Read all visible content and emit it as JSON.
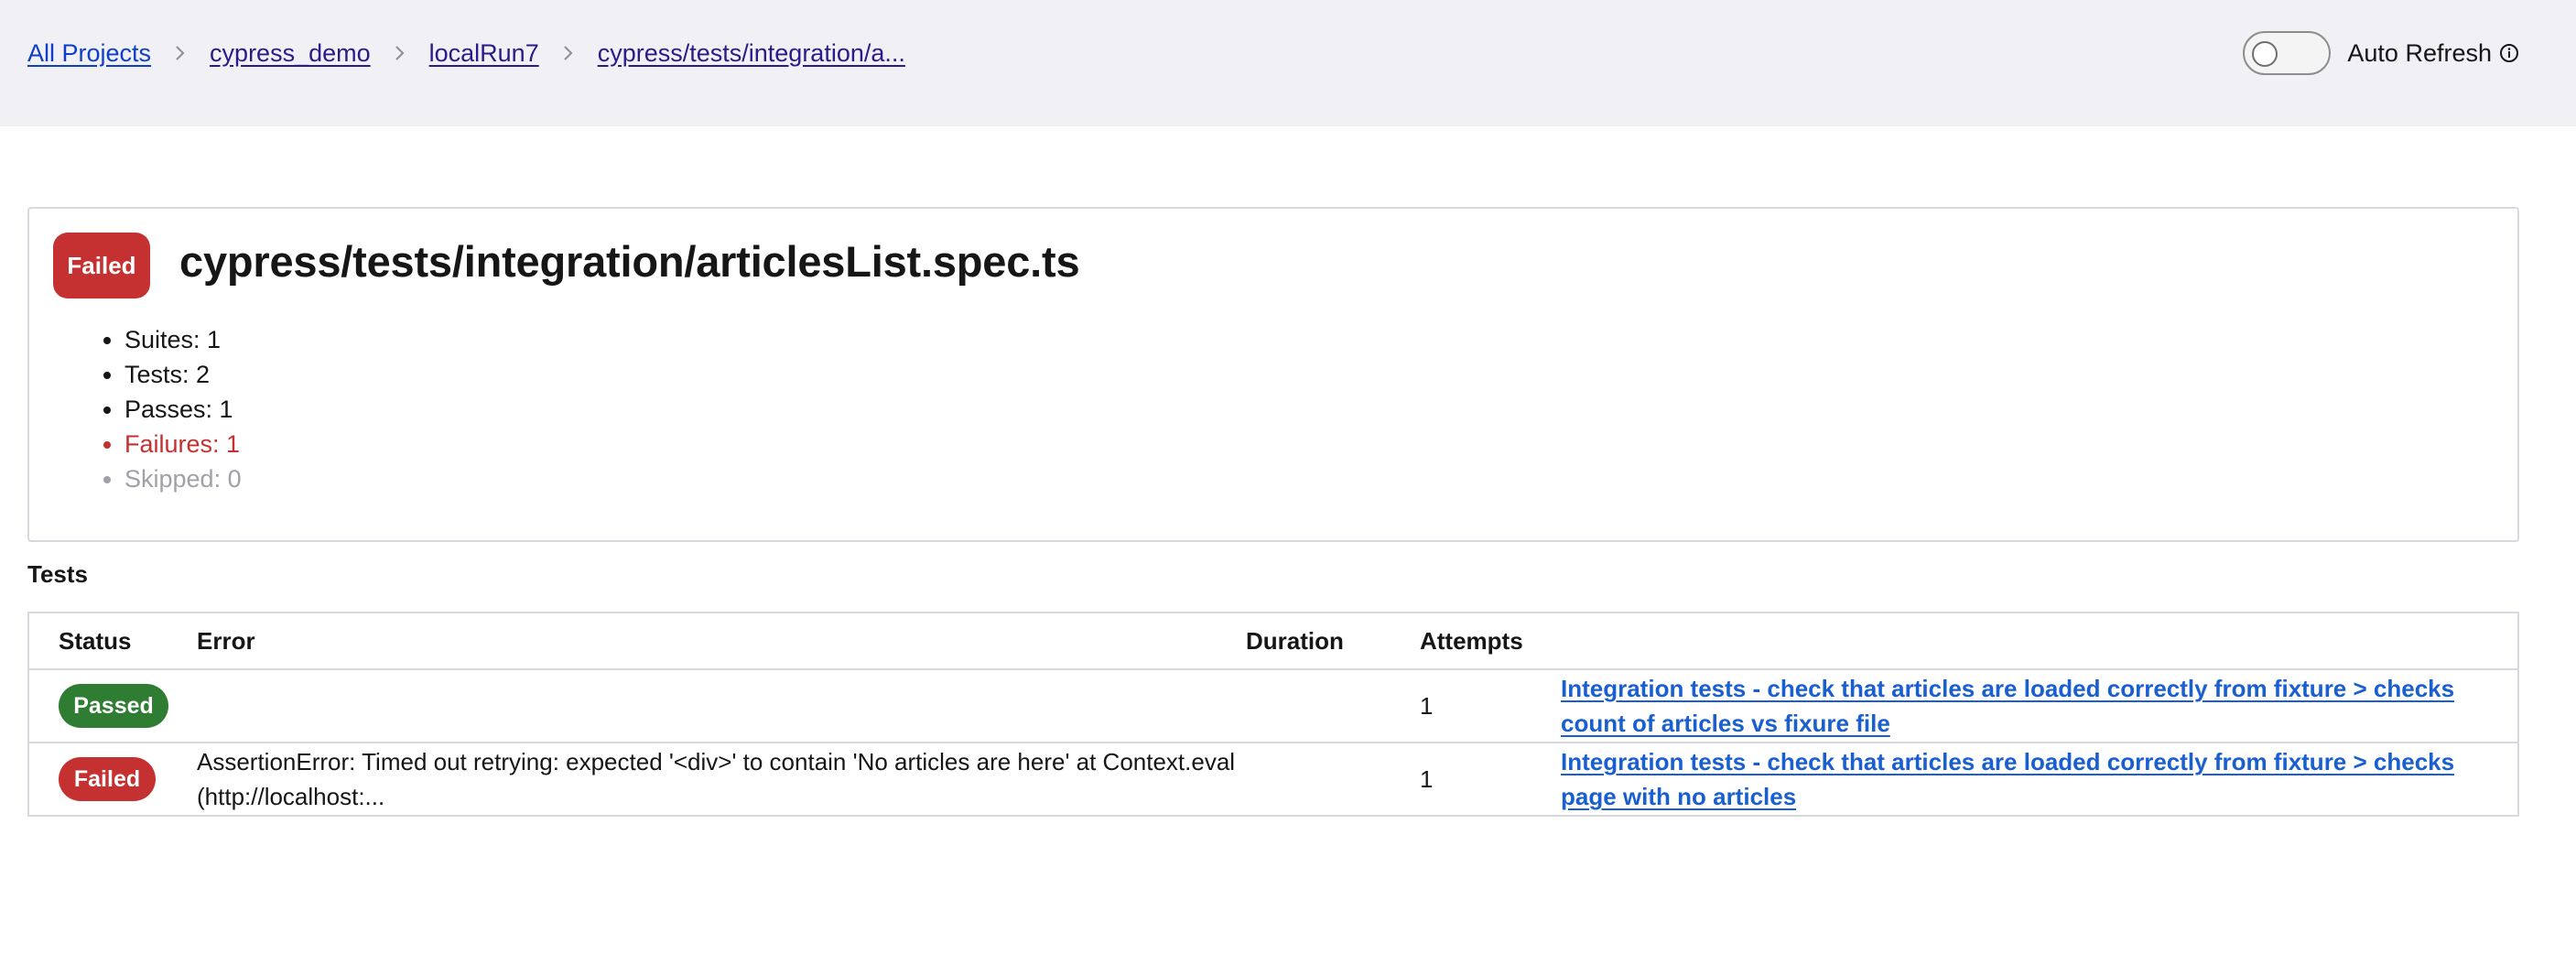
{
  "breadcrumb": {
    "items": [
      "All Projects",
      "cypress_demo",
      "localRun7",
      "cypress/tests/integration/a..."
    ]
  },
  "auto_refresh": {
    "label": "Auto Refresh",
    "enabled": false
  },
  "spec": {
    "status": "Failed",
    "title": "cypress/tests/integration/articlesList.spec.ts",
    "stats": {
      "suites": "Suites: 1",
      "tests": "Tests: 2",
      "passes": "Passes: 1",
      "failures": "Failures: 1",
      "skipped": "Skipped: 0"
    }
  },
  "tests_section": {
    "heading": "Tests",
    "columns": [
      "Status",
      "Error",
      "Duration",
      "Attempts",
      ""
    ],
    "rows": [
      {
        "status": "Passed",
        "error": "",
        "duration": "",
        "attempts": "1",
        "title": "Integration tests - check that articles are loaded correctly from fixture > checks count of articles vs fixure file"
      },
      {
        "status": "Failed",
        "error": "AssertionError: Timed out retrying: expected '<div>' to contain 'No articles are here' at Context.eval (http://localhost:...",
        "duration": "",
        "attempts": "1",
        "title": "Integration tests - check that articles are loaded correctly from fixture > checks page with no articles"
      }
    ]
  },
  "colors": {
    "failed": "#c53030",
    "passed": "#2e7d32",
    "link": "#1a5fd0",
    "topbar": "#f0f0f5"
  }
}
